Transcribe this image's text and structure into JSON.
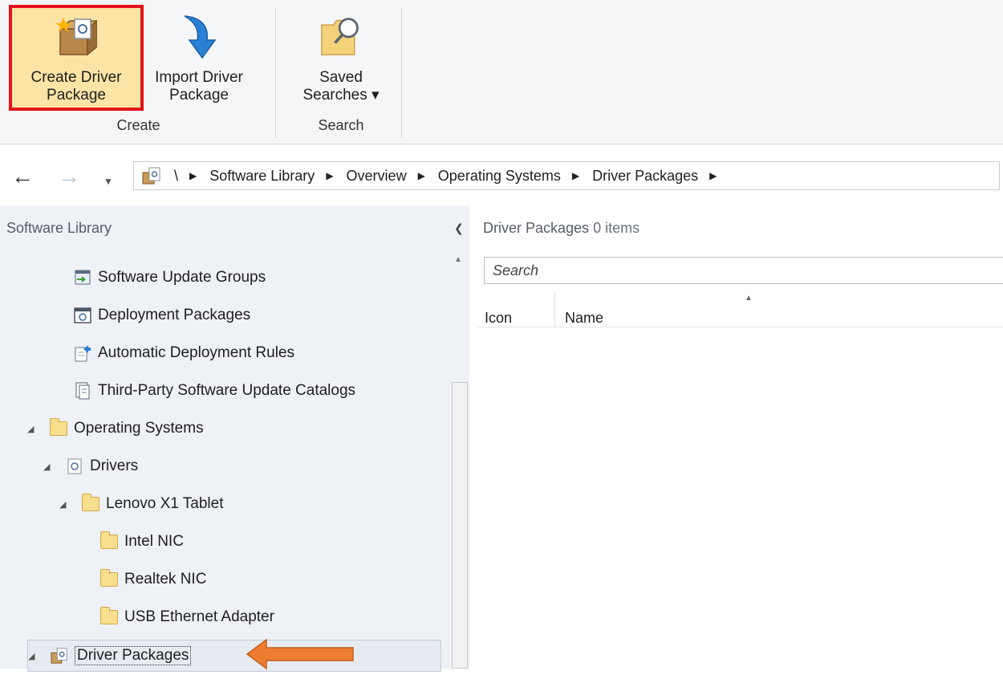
{
  "ribbon": {
    "buttons": {
      "create_driver_package": "Create Driver\nPackage",
      "import_driver_package": "Import Driver\nPackage",
      "saved_searches": "Saved\nSearches ▾"
    },
    "groups": {
      "create": "Create",
      "search": "Search"
    }
  },
  "address_bar": {
    "crumbs": [
      "\\",
      "Software Library",
      "Overview",
      "Operating Systems",
      "Driver Packages"
    ]
  },
  "nav_pane": {
    "title": "Software Library",
    "items": [
      {
        "label": "Software Update Groups",
        "icon": "update-group-icon"
      },
      {
        "label": "Deployment Packages",
        "icon": "deployment-package-icon"
      },
      {
        "label": "Automatic Deployment Rules",
        "icon": "deployment-rule-icon"
      },
      {
        "label": "Third-Party Software Update Catalogs",
        "icon": "catalog-icon"
      },
      {
        "label": "Operating Systems",
        "icon": "folder-icon"
      },
      {
        "label": "Drivers",
        "icon": "driver-icon"
      },
      {
        "label": "Lenovo X1 Tablet",
        "icon": "folder-icon"
      },
      {
        "label": "Intel NIC",
        "icon": "folder-icon"
      },
      {
        "label": "Realtek NIC",
        "icon": "folder-icon"
      },
      {
        "label": "USB Ethernet Adapter",
        "icon": "folder-icon"
      },
      {
        "label": "Driver Packages",
        "icon": "driver-package-icon"
      }
    ]
  },
  "content": {
    "title": "Driver Packages",
    "count": "0 items",
    "search_placeholder": "Search",
    "columns": [
      "Icon",
      "Name"
    ]
  },
  "colors": {
    "highlight_border": "#e3141b",
    "annotation_arrow": "#ed7d31",
    "selected_bg": "#fbe4a6"
  }
}
